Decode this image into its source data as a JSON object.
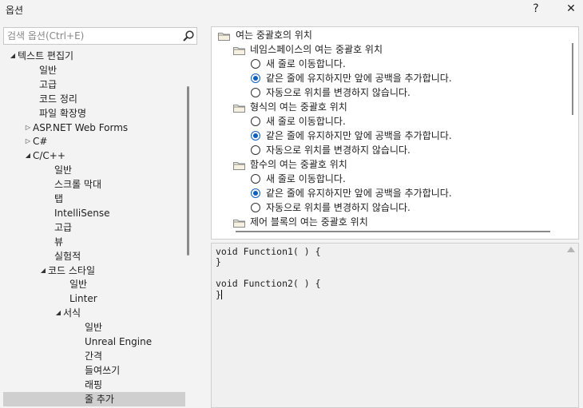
{
  "window": {
    "title": "옵션",
    "help_glyph": "?",
    "close_glyph": "✕"
  },
  "search": {
    "placeholder": "검색 옵션(Ctrl+E)"
  },
  "tree": [
    {
      "label": "텍스트 편집기",
      "expanded": true
    },
    {
      "label": "일반"
    },
    {
      "label": "고급"
    },
    {
      "label": "코드 정리"
    },
    {
      "label": "파일 확장명"
    },
    {
      "label": "ASP.NET Web Forms",
      "expanded": false
    },
    {
      "label": "C#",
      "expanded": false
    },
    {
      "label": "C/C++",
      "expanded": true
    },
    {
      "label": "일반"
    },
    {
      "label": "스크롤 막대"
    },
    {
      "label": "탭"
    },
    {
      "label": "IntelliSense"
    },
    {
      "label": "고급"
    },
    {
      "label": "뷰"
    },
    {
      "label": "실험적"
    },
    {
      "label": "코드 스타일",
      "expanded": true
    },
    {
      "label": "일반"
    },
    {
      "label": "Linter"
    },
    {
      "label": "서식",
      "expanded": true
    },
    {
      "label": "일반"
    },
    {
      "label": "Unreal Engine"
    },
    {
      "label": "간격"
    },
    {
      "label": "들여쓰기"
    },
    {
      "label": "래핑"
    },
    {
      "label": "줄 추가",
      "selected": true
    }
  ],
  "options": {
    "group_title": "여는 중괄호의 위치",
    "sections": [
      {
        "title": "네임스페이스의 여는 중괄호 위치",
        "choices": [
          {
            "label": "새 줄로 이동합니다.",
            "checked": false
          },
          {
            "label": "같은 줄에 유지하지만 앞에 공백을 추가합니다.",
            "checked": true
          },
          {
            "label": "자동으로 위치를 변경하지 않습니다.",
            "checked": false
          }
        ]
      },
      {
        "title": "형식의 여는 중괄호 위치",
        "choices": [
          {
            "label": "새 줄로 이동합니다.",
            "checked": false
          },
          {
            "label": "같은 줄에 유지하지만 앞에 공백을 추가합니다.",
            "checked": true
          },
          {
            "label": "자동으로 위치를 변경하지 않습니다.",
            "checked": false
          }
        ]
      },
      {
        "title": "함수의 여는 중괄호 위치",
        "choices": [
          {
            "label": "새 줄로 이동합니다.",
            "checked": false
          },
          {
            "label": "같은 줄에 유지하지만 앞에 공백을 추가합니다.",
            "checked": true
          },
          {
            "label": "자동으로 위치를 변경하지 않습니다.",
            "checked": false
          }
        ]
      },
      {
        "title": "제어 블록의 여는 중괄호 위치",
        "choices": []
      }
    ]
  },
  "preview": {
    "lines": [
      "void Function1( ) {",
      "}",
      "",
      "void Function2( ) {",
      "}"
    ]
  }
}
